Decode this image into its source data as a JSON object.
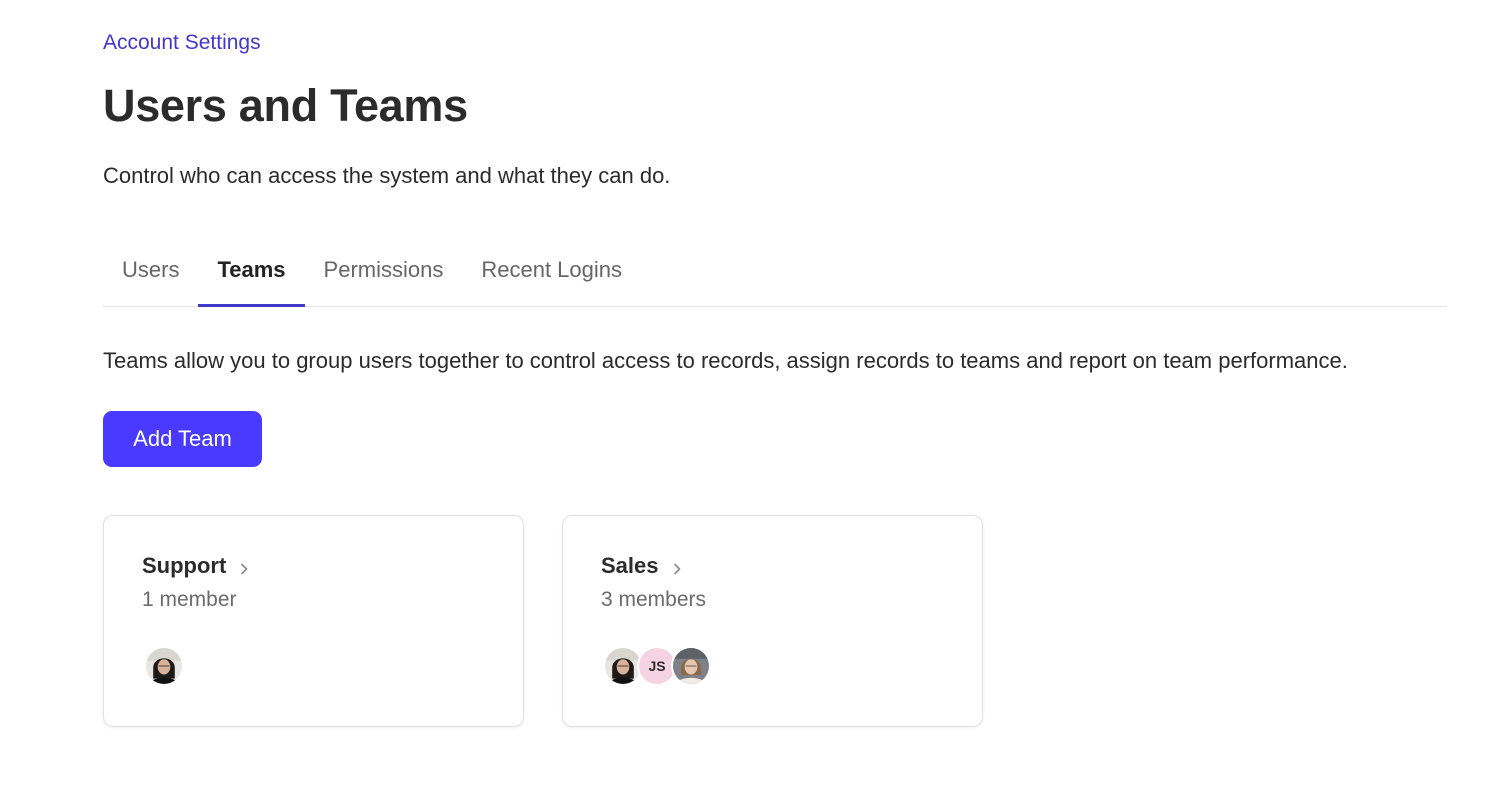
{
  "breadcrumb": {
    "label": "Account Settings"
  },
  "header": {
    "title": "Users and Teams",
    "subtitle": "Control who can access the system and what they can do."
  },
  "tabs": [
    {
      "label": "Users",
      "active": false
    },
    {
      "label": "Teams",
      "active": true
    },
    {
      "label": "Permissions",
      "active": false
    },
    {
      "label": "Recent Logins",
      "active": false
    }
  ],
  "teams_tab": {
    "description": "Teams allow you to group users together to control access to records, assign records to teams and report on team performance.",
    "add_button_label": "Add Team"
  },
  "teams": [
    {
      "name": "Support",
      "member_count_text": "1 member",
      "avatars": [
        {
          "type": "photo",
          "icon": "user-photo-dark-hair-icon"
        }
      ]
    },
    {
      "name": "Sales",
      "member_count_text": "3 members",
      "avatars": [
        {
          "type": "photo",
          "icon": "user-photo-dark-hair-icon"
        },
        {
          "type": "initials",
          "initials": "JS",
          "color": "#f5d3e2"
        },
        {
          "type": "photo",
          "icon": "user-photo-light-hair-icon"
        }
      ]
    }
  ],
  "colors": {
    "accent": "#4a3aff",
    "link": "#4338ca",
    "tab_underline": "#4338ca"
  }
}
